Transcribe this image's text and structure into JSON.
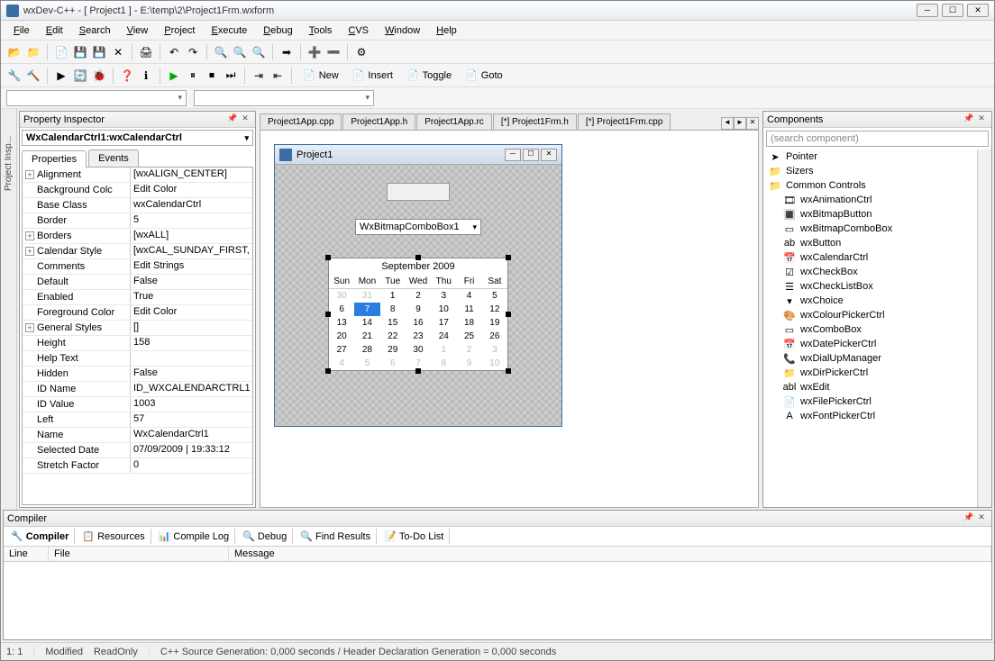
{
  "title": "wxDev-C++  - [ Project1 ] - E:\\temp\\2\\Project1Frm.wxform",
  "menus": [
    "File",
    "Edit",
    "Search",
    "View",
    "Project",
    "Execute",
    "Debug",
    "Tools",
    "CVS",
    "Window",
    "Help"
  ],
  "tb2": {
    "new": "New",
    "insert": "Insert",
    "toggle": "Toggle",
    "goto": "Goto"
  },
  "inspector": {
    "title": "Property Inspector",
    "selected": "WxCalendarCtrl1:wxCalendarCtrl",
    "tabs": [
      "Properties",
      "Events"
    ],
    "props": [
      {
        "exp": "+",
        "name": "Alignment",
        "val": "[wxALIGN_CENTER]"
      },
      {
        "name": "Background Colc",
        "val": "Edit Color"
      },
      {
        "name": "Base Class",
        "val": "wxCalendarCtrl"
      },
      {
        "name": "Border",
        "val": "5"
      },
      {
        "exp": "+",
        "name": "Borders",
        "val": "[wxALL]"
      },
      {
        "exp": "+",
        "name": "Calendar Style",
        "val": "[wxCAL_SUNDAY_FIRST,"
      },
      {
        "name": "Comments",
        "val": "Edit Strings"
      },
      {
        "name": "Default",
        "val": "False"
      },
      {
        "name": "Enabled",
        "val": "True"
      },
      {
        "name": "Foreground Color",
        "val": "Edit Color"
      },
      {
        "exp": "+",
        "name": "General Styles",
        "val": "[]"
      },
      {
        "name": "Height",
        "val": "158"
      },
      {
        "name": "Help Text",
        "val": ""
      },
      {
        "name": "Hidden",
        "val": "False"
      },
      {
        "name": "ID Name",
        "val": "ID_WXCALENDARCTRL1"
      },
      {
        "name": "ID Value",
        "val": "1003"
      },
      {
        "name": "Left",
        "val": "57"
      },
      {
        "name": "Name",
        "val": "WxCalendarCtrl1"
      },
      {
        "name": "Selected Date",
        "val": "07/09/2009 | 19:33:12"
      },
      {
        "name": "Stretch Factor",
        "val": "0"
      }
    ]
  },
  "editor_tabs": [
    "Project1App.cpp",
    "Project1App.h",
    "Project1App.rc",
    "[*] Project1Frm.h",
    "[*] Project1Frm.cpp"
  ],
  "form": {
    "title": "Project1",
    "combo": "WxBitmapComboBox1",
    "cal_month": "September 2009",
    "cal_days": [
      "Sun",
      "Mon",
      "Tue",
      "Wed",
      "Thu",
      "Fri",
      "Sat"
    ],
    "cal_cells": [
      {
        "d": "30",
        "prev": true
      },
      {
        "d": "31",
        "prev": true
      },
      {
        "d": "1"
      },
      {
        "d": "2"
      },
      {
        "d": "3"
      },
      {
        "d": "4"
      },
      {
        "d": "5"
      },
      {
        "d": "6"
      },
      {
        "d": "7",
        "sel": true
      },
      {
        "d": "8"
      },
      {
        "d": "9"
      },
      {
        "d": "10"
      },
      {
        "d": "11"
      },
      {
        "d": "12"
      },
      {
        "d": "13"
      },
      {
        "d": "14"
      },
      {
        "d": "15"
      },
      {
        "d": "16"
      },
      {
        "d": "17"
      },
      {
        "d": "18"
      },
      {
        "d": "19"
      },
      {
        "d": "20"
      },
      {
        "d": "21"
      },
      {
        "d": "22"
      },
      {
        "d": "23"
      },
      {
        "d": "24"
      },
      {
        "d": "25"
      },
      {
        "d": "26"
      },
      {
        "d": "27"
      },
      {
        "d": "28"
      },
      {
        "d": "29"
      },
      {
        "d": "30"
      },
      {
        "d": "1",
        "prev": true
      },
      {
        "d": "2",
        "prev": true
      },
      {
        "d": "3",
        "prev": true
      },
      {
        "d": "4",
        "prev": true
      },
      {
        "d": "5",
        "prev": true
      },
      {
        "d": "6",
        "prev": true
      },
      {
        "d": "7",
        "prev": true
      },
      {
        "d": "8",
        "prev": true
      },
      {
        "d": "9",
        "prev": true
      },
      {
        "d": "10",
        "prev": true
      }
    ]
  },
  "components": {
    "title": "Components",
    "search_placeholder": "(search component)",
    "tree": [
      {
        "icon": "➤",
        "label": "Pointer",
        "indent": 0
      },
      {
        "icon": "📁",
        "label": "Sizers",
        "indent": 0
      },
      {
        "icon": "📁",
        "label": "Common Controls",
        "indent": 0,
        "open": true
      },
      {
        "icon": "🎞",
        "label": "wxAnimationCtrl",
        "indent": 1
      },
      {
        "icon": "🔳",
        "label": "wxBitmapButton",
        "indent": 1
      },
      {
        "icon": "▭",
        "label": "wxBitmapComboBox",
        "indent": 1
      },
      {
        "icon": "ab",
        "label": "wxButton",
        "indent": 1
      },
      {
        "icon": "📅",
        "label": "wxCalendarCtrl",
        "indent": 1
      },
      {
        "icon": "☑",
        "label": "wxCheckBox",
        "indent": 1
      },
      {
        "icon": "☰",
        "label": "wxCheckListBox",
        "indent": 1
      },
      {
        "icon": "▾",
        "label": "wxChoice",
        "indent": 1
      },
      {
        "icon": "🎨",
        "label": "wxColourPickerCtrl",
        "indent": 1
      },
      {
        "icon": "▭",
        "label": "wxComboBox",
        "indent": 1
      },
      {
        "icon": "📅",
        "label": "wxDatePickerCtrl",
        "indent": 1
      },
      {
        "icon": "📞",
        "label": "wxDialUpManager",
        "indent": 1
      },
      {
        "icon": "📁",
        "label": "wxDirPickerCtrl",
        "indent": 1
      },
      {
        "icon": "abl",
        "label": "wxEdit",
        "indent": 1
      },
      {
        "icon": "📄",
        "label": "wxFilePickerCtrl",
        "indent": 1
      },
      {
        "icon": "A",
        "label": "wxFontPickerCtrl",
        "indent": 1
      }
    ]
  },
  "compiler": {
    "title": "Compiler",
    "tabs": [
      "Compiler",
      "Resources",
      "Compile Log",
      "Debug",
      "Find Results",
      "To-Do List"
    ],
    "cols": {
      "line": "Line",
      "file": "File",
      "message": "Message"
    }
  },
  "status": {
    "pos": "1: 1",
    "mod": "Modified",
    "ro": "ReadOnly",
    "msg": "C++ Source Generation: 0,000 seconds / Header Declaration Generation = 0,000 seconds"
  },
  "left_strip": "Project Insp..."
}
